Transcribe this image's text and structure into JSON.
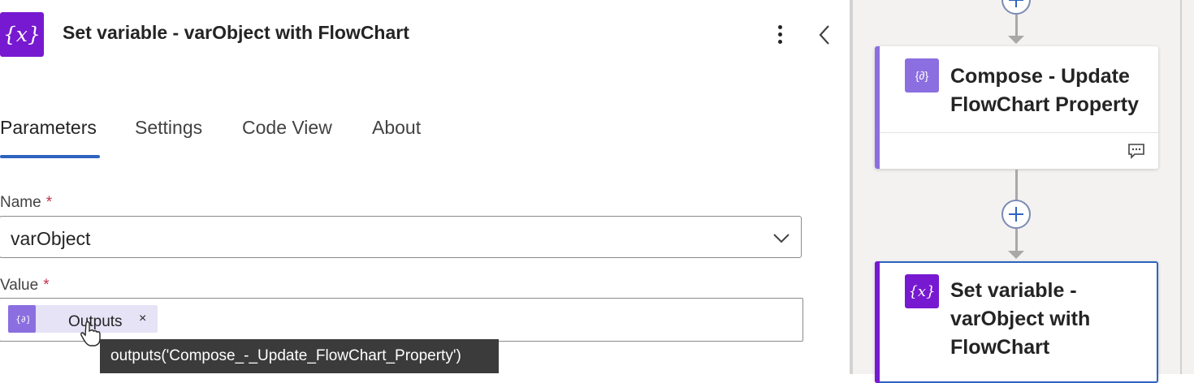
{
  "panel": {
    "title": "Set variable - varObject with FlowChart",
    "icon_text": "{x}"
  },
  "tabs": [
    {
      "label": "Parameters",
      "active": true
    },
    {
      "label": "Settings",
      "active": false
    },
    {
      "label": "Code View",
      "active": false
    },
    {
      "label": "About",
      "active": false
    }
  ],
  "fields": {
    "name": {
      "label": "Name",
      "required_mark": "*",
      "value": "varObject"
    },
    "value": {
      "label": "Value",
      "required_mark": "*",
      "token_label": "Outputs",
      "token_remove": "×"
    }
  },
  "tooltip": "outputs('Compose_-_Update_FlowChart_Property')",
  "canvas": {
    "compose_card": {
      "title": "Compose - Update FlowChart Property",
      "icon_text": "{∂}"
    },
    "set_variable_card": {
      "title": "Set variable - varObject with FlowChart",
      "icon_text": "{x}"
    }
  },
  "colors": {
    "variable_icon": "#7719d1",
    "compose_icon": "#8b6fe0",
    "active_tab": "#2f63c0",
    "selected_card_border": "#2f63c0",
    "required": "#c4314b"
  }
}
